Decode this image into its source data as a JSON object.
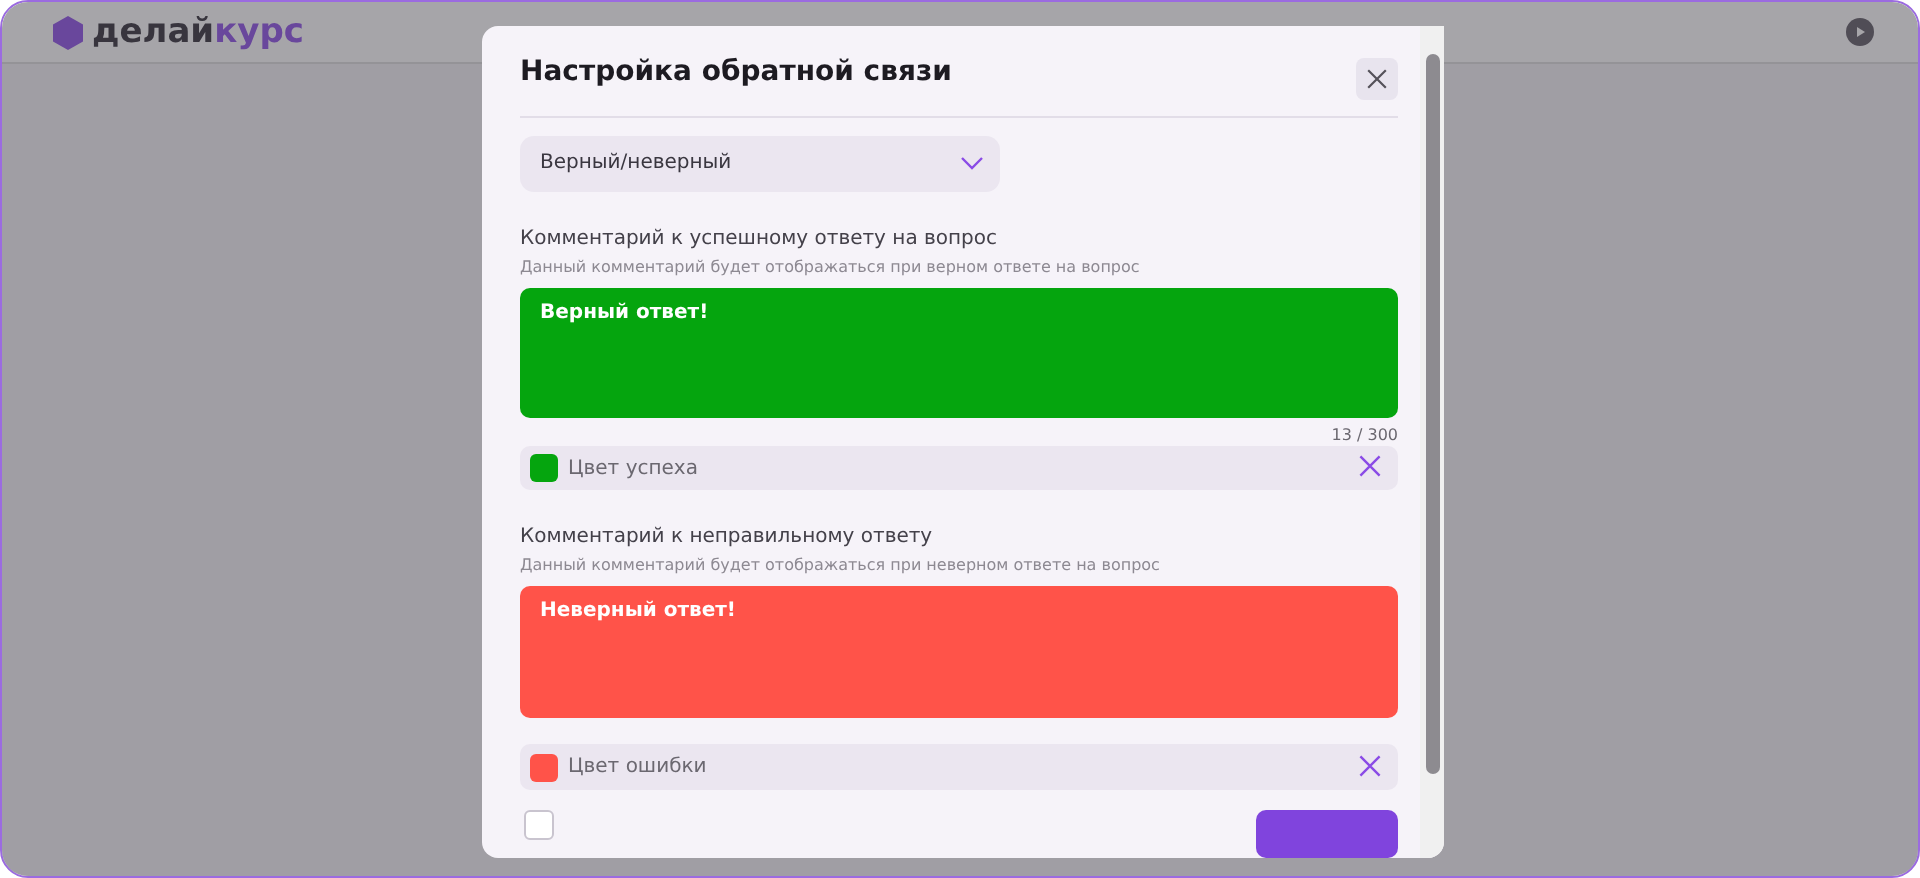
{
  "app": {
    "logo_dark": "делай",
    "logo_accent": "курс"
  },
  "dialog": {
    "title": "Настройка обратной связи",
    "feedback_type": {
      "value": "Верный/неверный"
    },
    "sections": [
      {
        "label": "Комментарий к успешному ответу на вопрос",
        "hint": "Данный комментарий будет отображаться при верном ответе на вопрос",
        "value": "Верный ответ!",
        "color": "#05a50e",
        "counter": "13 / 300",
        "color_label": "Цвет успеха"
      },
      {
        "label": "Комментарий к неправильному ответу",
        "hint": "Данный комментарий будет отображаться при неверном ответе на вопрос",
        "value": "Неверный ответ!",
        "color": "#ff5349",
        "color_label": "Цвет ошибки"
      }
    ],
    "footer": {
      "checkbox": {
        "checked": false
      }
    }
  }
}
